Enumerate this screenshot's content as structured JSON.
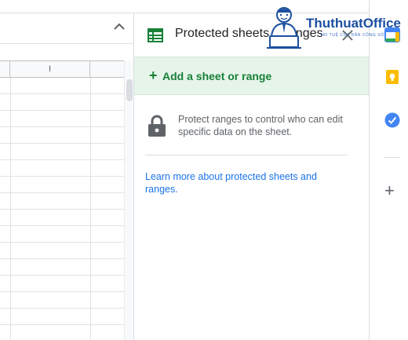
{
  "grid": {
    "column_header": "I"
  },
  "panel": {
    "title": "Protected sheets & ranges",
    "add_label": "Add a sheet or range",
    "add_plus": "+",
    "description": "Protect ranges to control who can edit specific data on the sheet.",
    "learn_more": "Learn more about protected sheets and ranges."
  },
  "side_panel": {
    "add_plus": "+"
  },
  "watermark": {
    "brand": "ThuthuatOffice",
    "tagline": "TRÍ TUỆ CỦA DÂN CÔNG SỞ"
  },
  "icons": {
    "sheets": "sheets-icon",
    "lock": "lock-icon",
    "close": "close-icon",
    "calendar": "calendar-icon",
    "keep": "keep-icon",
    "tasks": "tasks-icon"
  },
  "colors": {
    "add_bg": "#e6f4ea",
    "accent_green": "#188038",
    "link_blue": "#1a73e8",
    "keep_yellow": "#fbbc04",
    "tasks_blue": "#4285f4"
  }
}
